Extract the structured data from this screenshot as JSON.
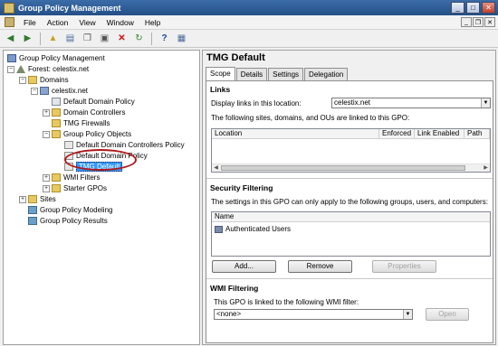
{
  "window": {
    "title": "Group Policy Management"
  },
  "menu": [
    "File",
    "Action",
    "View",
    "Window",
    "Help"
  ],
  "tree": {
    "root": "Group Policy Management",
    "forest": "Forest: celestix.net",
    "domains": "Domains",
    "domain": "celestix.net",
    "default_domain_policy": "Default Domain Policy",
    "domain_controllers": "Domain Controllers",
    "tmg_firewalls": "TMG Firewalls",
    "gpo_folder": "Group Policy Objects",
    "gpo_ddcp": "Default Domain Controllers Policy",
    "gpo_ddp": "Default Domain Policy",
    "gpo_tmg": "TMG Default",
    "wmi_filters": "WMI Filters",
    "starter_gpos": "Starter GPOs",
    "sites": "Sites",
    "modeling": "Group Policy Modeling",
    "results": "Group Policy Results"
  },
  "details": {
    "title": "TMG Default",
    "tabs": [
      "Scope",
      "Details",
      "Settings",
      "Delegation"
    ],
    "links": {
      "header": "Links",
      "display_label": "Display links in this location:",
      "location_value": "celestix.net",
      "description": "The following sites, domains, and OUs are linked to this GPO:",
      "columns": [
        "Location",
        "Enforced",
        "Link Enabled",
        "Path"
      ]
    },
    "security": {
      "header": "Security Filtering",
      "description": "The settings in this GPO can only apply to the following groups, users, and computers:",
      "column": "Name",
      "entries": [
        "Authenticated Users"
      ],
      "add_label": "Add...",
      "remove_label": "Remove",
      "properties_label": "Properties"
    },
    "wmi": {
      "header": "WMI Filtering",
      "description": "This GPO is linked to the following WMI filter:",
      "filter_value": "<none>",
      "open_label": "Open"
    }
  }
}
